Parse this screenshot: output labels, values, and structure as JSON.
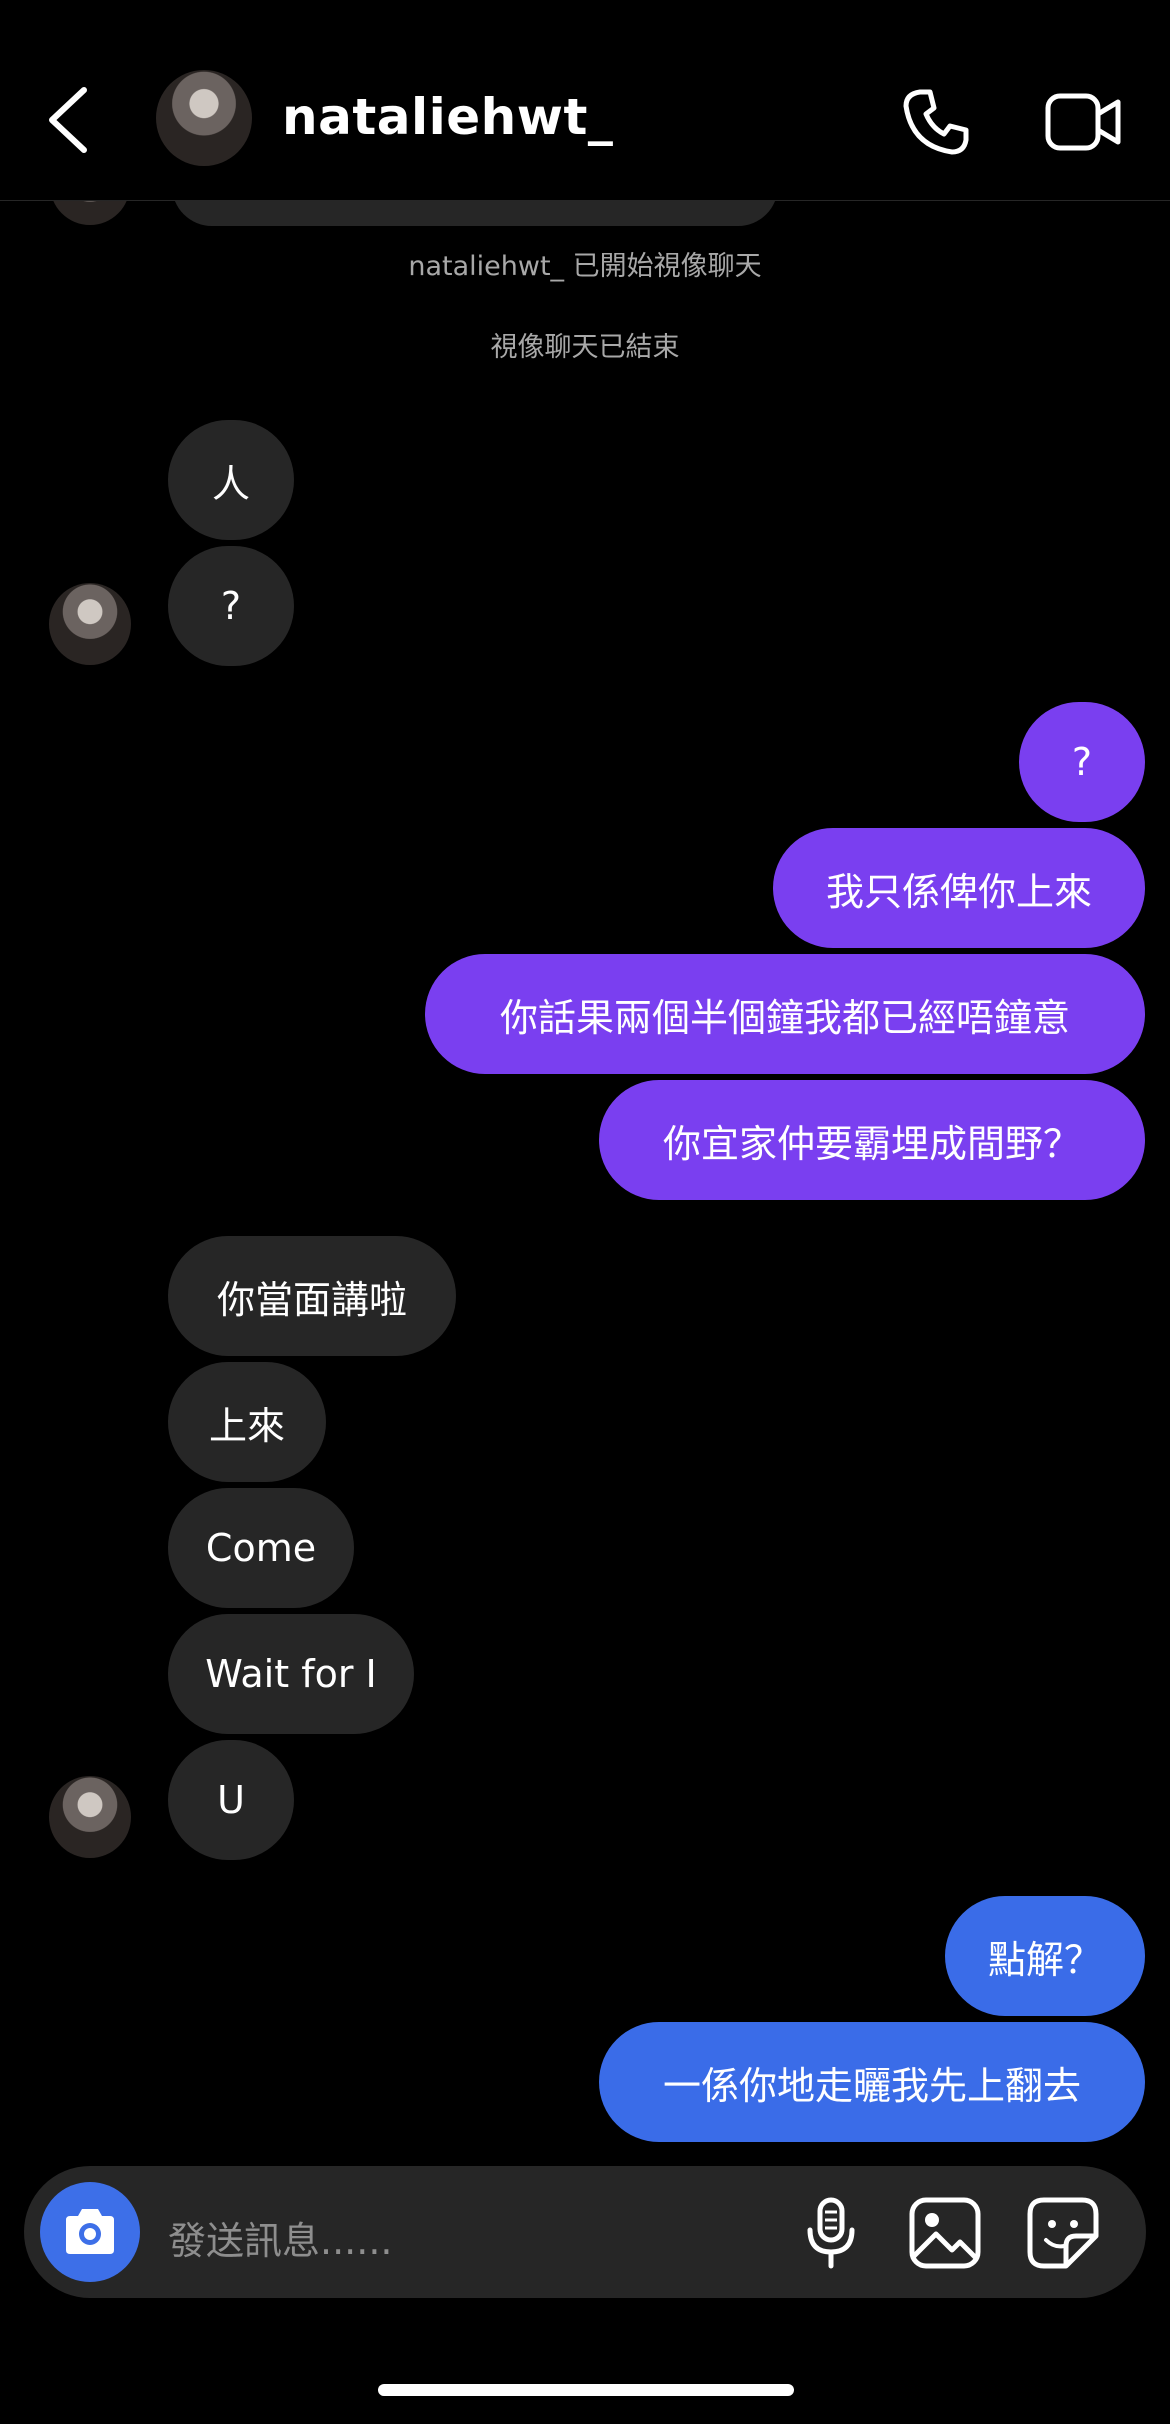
{
  "header": {
    "username": "nataliehwt_",
    "icons": [
      "chevron-left-icon",
      "phone-icon",
      "video-camera-icon"
    ]
  },
  "system": {
    "video_started": "nataliehwt_ 已開始視像聊天",
    "video_ended": "視像聊天已結束"
  },
  "messages": {
    "in1": "人",
    "in2": "?",
    "out1": "?",
    "out2": "我只係俾你上來",
    "out3": "你話果兩個半個鐘我都已經唔鐘意",
    "out4": "你宜家仲要霸埋成間野？",
    "in3": "你當面講啦",
    "in4": "上來",
    "in5": "Come",
    "in6": "Wait for I",
    "in7": "U",
    "out5": "點解？",
    "out6": "一係你地走曬我先上翻去"
  },
  "composer": {
    "placeholder": "發送訊息......",
    "icons": [
      "camera-icon",
      "microphone-icon",
      "image-icon",
      "sticker-icon"
    ]
  },
  "colors": {
    "background": "#000000",
    "incoming_bubble": "#262626",
    "outgoing_bubble_purple": "#7a3ff0",
    "outgoing_bubble_blue": "#3a6ce8",
    "camera_button": "#3d6fe8"
  }
}
